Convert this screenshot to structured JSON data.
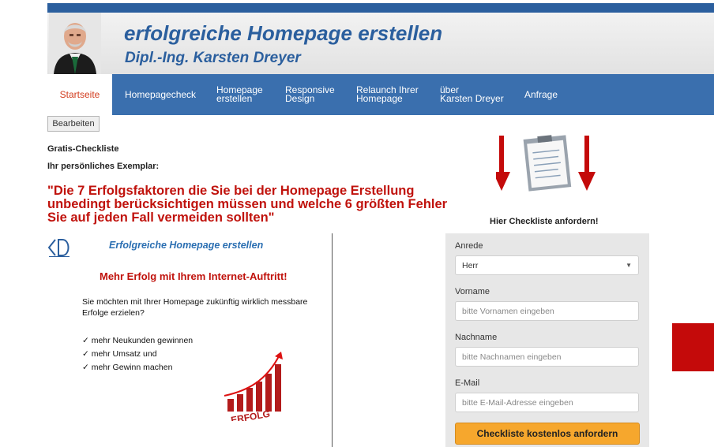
{
  "header": {
    "title": "erfolgreiche Homepage erstellen",
    "subtitle": "Dipl.-Ing. Karsten Dreyer"
  },
  "nav": {
    "items": [
      {
        "label": "Startseite",
        "active": true
      },
      {
        "label": "Homepagecheck"
      },
      {
        "label": "Homepage\nerstellen"
      },
      {
        "label": "Responsive\nDesign"
      },
      {
        "label": "Relaunch Ihrer\nHomepage"
      },
      {
        "label": "über\nKarsten Dreyer"
      },
      {
        "label": "Anfrage"
      }
    ]
  },
  "edit_button": "Bearbeiten",
  "content": {
    "label1": "Gratis-Checkliste",
    "label2": "Ihr persönliches Exemplar:",
    "headline": "\"Die 7 Erfolgsfaktoren die Sie bei der Homepage Erstellung unbedingt berücksichtigen müssen und welche 6 größten Fehler Sie auf jeden Fall vermeiden sollten\""
  },
  "preview": {
    "title": "Erfolgreiche Homepage erstellen",
    "subtitle": "Mehr Erfolg mit Ihrem Internet-Auftritt!",
    "intro": "Sie möchten mit Ihrer Homepage zukünftig wirklich messbare Erfolge erzielen?",
    "benefits": [
      "mehr Neukunden gewinnen",
      "mehr Umsatz und",
      "mehr Gewinn machen"
    ],
    "chart_word": "ERFOLG"
  },
  "form": {
    "heading": "Hier Checkliste anfordern!",
    "anrede_label": "Anrede",
    "anrede_value": "Herr",
    "vorname_label": "Vorname",
    "vorname_placeholder": "bitte Vornamen eingeben",
    "nachname_label": "Nachname",
    "nachname_placeholder": "bitte Nachnamen eingeben",
    "email_label": "E-Mail",
    "email_placeholder": "bitte E-Mail-Adresse eingeben",
    "submit_label": "Checkliste kostenlos anfordern"
  },
  "colors": {
    "brand_blue": "#2b5f9e",
    "headline_red": "#c0120c",
    "button_orange": "#f6a72d",
    "accent_red": "#c40a0a"
  }
}
